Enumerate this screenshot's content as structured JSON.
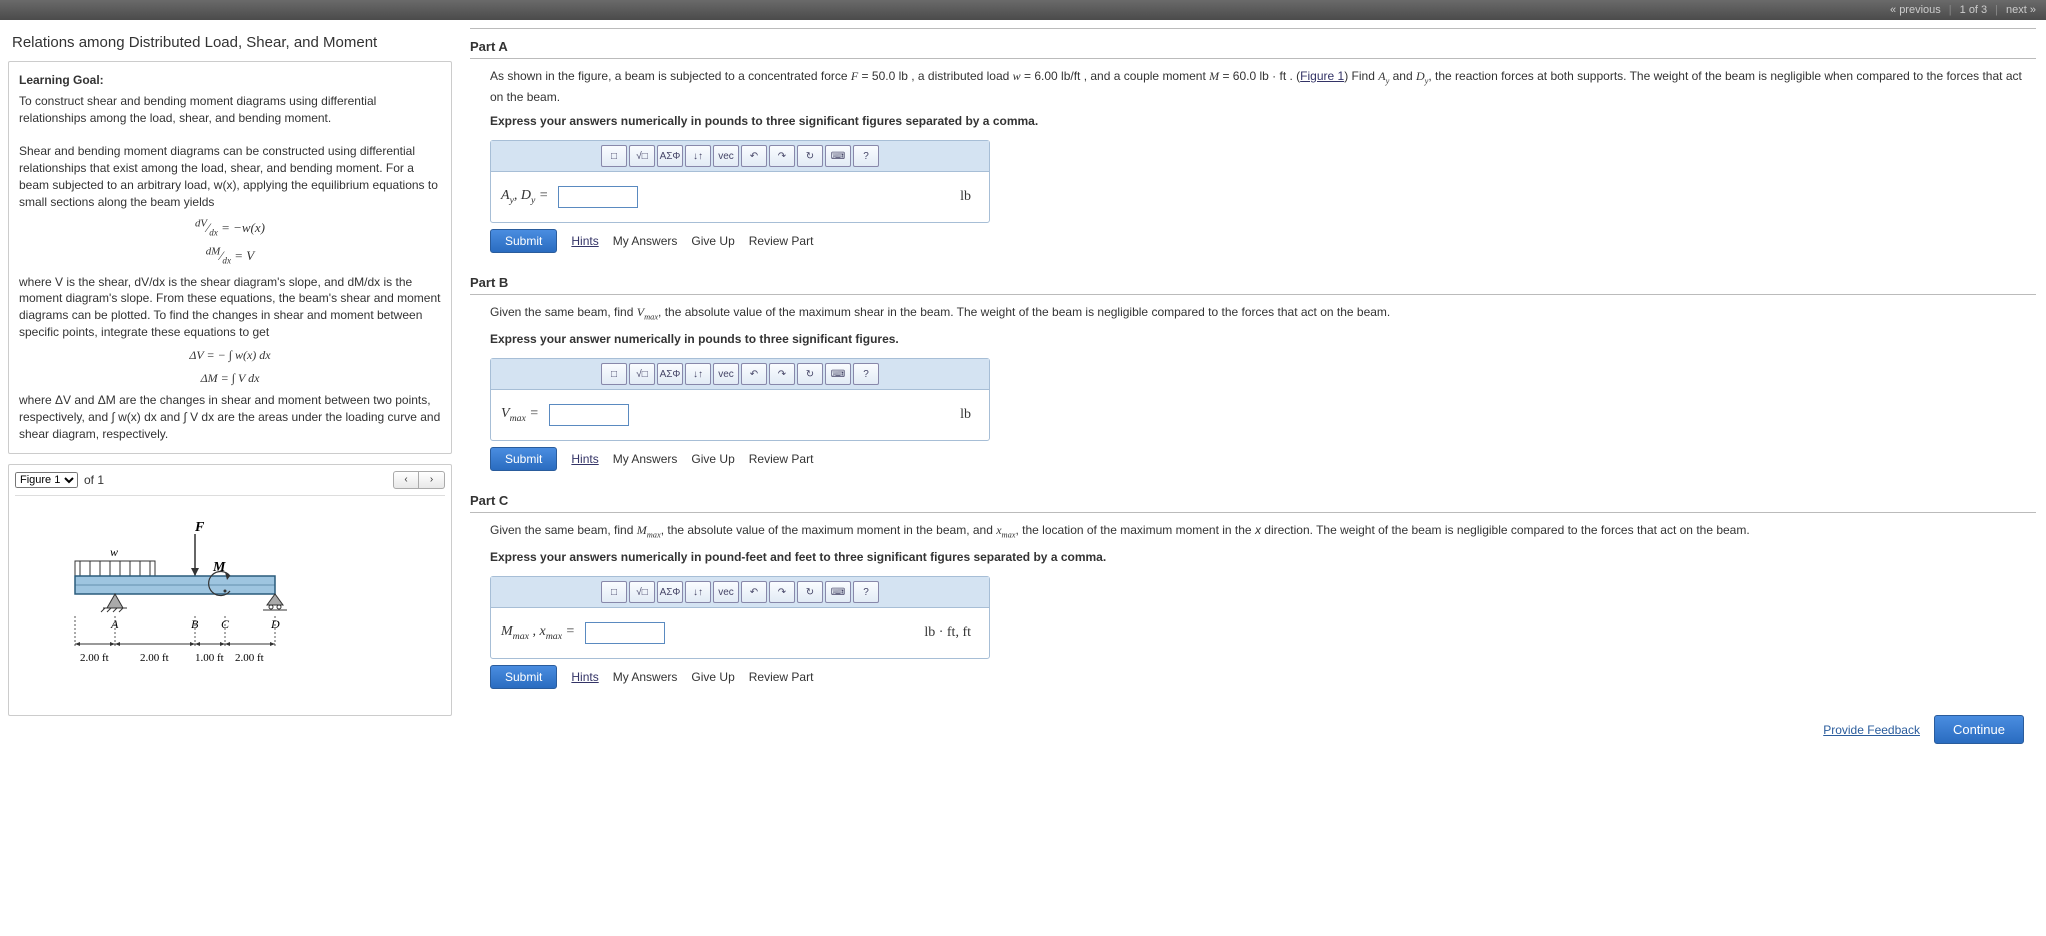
{
  "topnav": {
    "prev": "« previous",
    "pos": "1 of 3",
    "next": "next »"
  },
  "title": "Relations among Distributed Load, Shear, and Moment",
  "learning": {
    "heading": "Learning Goal:",
    "p1": "To construct shear and bending moment diagrams using differential relationships among the load, shear, and bending moment.",
    "p2": "Shear and bending moment diagrams can be constructed using differential relationships that exist among the load, shear, and bending moment. For a beam subjected to an arbitrary load, w(x), applying the equilibrium equations to small sections along the beam yields",
    "eq1": "dV/dx = −w(x)",
    "eq2": "dM/dx = V",
    "p3": "where V is the shear, dV/dx is the shear diagram's slope, and dM/dx is the moment diagram's slope. From these equations, the beam's shear and moment diagrams can be plotted. To find the changes in shear and moment between specific points, integrate these equations to get",
    "eq3": "ΔV = − ∫ w(x) dx",
    "eq4": "ΔM = ∫ V dx",
    "p4": "where ΔV and ΔM are the changes in shear and moment between two points, respectively, and ∫ w(x) dx and ∫ V dx are the areas under the loading curve and shear diagram, respectively."
  },
  "figure": {
    "select_label": "Figure 1",
    "count": "of 1",
    "labels": {
      "F": "F",
      "w": "w",
      "M": "M",
      "A": "A",
      "B": "B",
      "C": "C",
      "D": "D"
    },
    "dims": [
      "2.00 ft",
      "2.00 ft",
      "1.00 ft",
      "2.00 ft"
    ]
  },
  "partA": {
    "title": "Part A",
    "text1": "As shown in the figure, a beam is subjected to a concentrated force F = 50.0 lb , a distributed load w = 6.00 lb/ft , and a couple moment M = 60.0 lb · ft . (Figure 1) Find A_y and D_y, the reaction forces at both supports. The weight of the beam is negligible when compared to the forces that act on the beam.",
    "text2": "Express your answers numerically in pounds to three significant figures separated by a comma.",
    "input_label": "A_y, D_y =",
    "unit": "lb"
  },
  "partB": {
    "title": "Part B",
    "text1": "Given the same beam, find V_max, the absolute value of the maximum shear in the beam. The weight of the beam is negligible compared to the forces that act on the beam.",
    "text2": "Express your answer numerically in pounds to three significant figures.",
    "input_label": "V_max =",
    "unit": "lb"
  },
  "partC": {
    "title": "Part C",
    "text1": "Given the same beam, find M_max, the absolute value of the maximum moment in the beam, and x_max, the location of the maximum moment in the x direction. The weight of the beam is negligible compared to the forces that act on the beam.",
    "text2": "Express your answers numerically in pound-feet and feet to three significant figures separated by a comma.",
    "input_label": "M_max , x_max =",
    "unit": "lb · ft, ft"
  },
  "toolbar_icons": [
    "□",
    "√□",
    "ΑΣΦ",
    "↓↑",
    "vec",
    "↶",
    "↷",
    "↻",
    "⌨",
    "?"
  ],
  "actions": {
    "submit": "Submit",
    "hints": "Hints",
    "myans": "My Answers",
    "giveup": "Give Up",
    "review": "Review Part"
  },
  "footer": {
    "feedback": "Provide Feedback",
    "continue": "Continue"
  }
}
